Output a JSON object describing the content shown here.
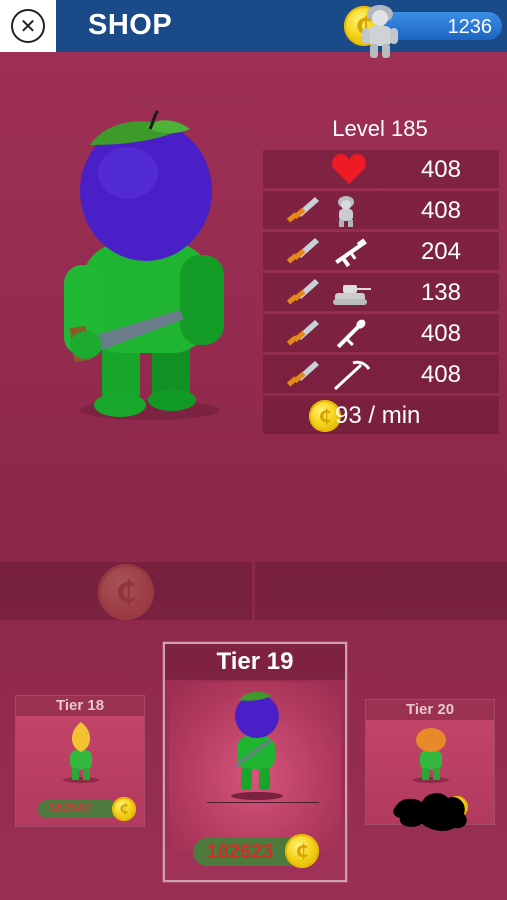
{
  "header": {
    "close_icon": "close-icon",
    "title": "SHOP",
    "coins": "1236"
  },
  "stats": {
    "level": "Level 185",
    "rows": [
      {
        "icon": "heart-icon",
        "value": "408"
      },
      {
        "icon": "soldier-icon",
        "value": "408"
      },
      {
        "icon": "rifle-icon",
        "value": "204"
      },
      {
        "icon": "tank-icon",
        "value": "138"
      },
      {
        "icon": "rocket-launcher-icon",
        "value": "408"
      },
      {
        "icon": "pickaxe-icon",
        "value": "408"
      }
    ],
    "income": "93 / min"
  },
  "toggle": {
    "left_icon": "coin-icon",
    "right_icon": "soldier-icon"
  },
  "cards": {
    "left": {
      "title": "Tier 18",
      "price": "182847"
    },
    "center": {
      "title": "Tier 19",
      "price": "182623"
    },
    "right": {
      "title": "Tier 20"
    }
  },
  "colors": {
    "header_bg": "#1a4a88",
    "background": "#932b4f",
    "coin_gold": "#f3d21a",
    "price_red": "#d42b2b",
    "pill_green": "#4d7a3c"
  }
}
